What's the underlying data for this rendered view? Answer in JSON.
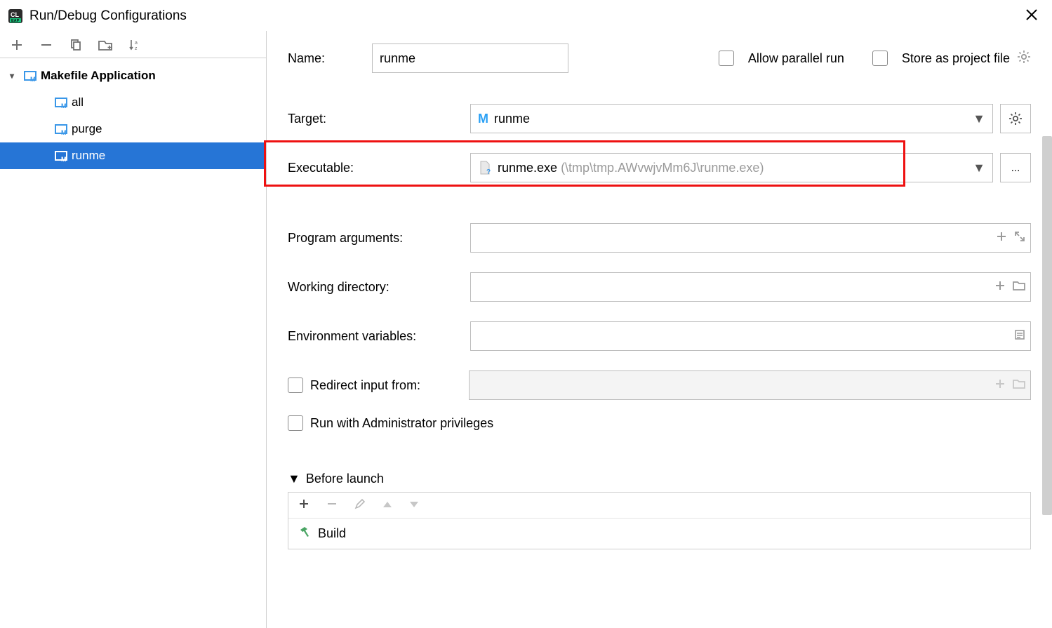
{
  "titlebar": {
    "title": "Run/Debug Configurations"
  },
  "sidebar": {
    "root_label": "Makefile Application",
    "items": [
      "all",
      "purge",
      "runme"
    ],
    "selected": "runme"
  },
  "form": {
    "name_label": "Name:",
    "name_value": "runme",
    "allow_parallel": "Allow parallel run",
    "store_as_project": "Store as project file",
    "target_label": "Target:",
    "target_value": "runme",
    "executable_label": "Executable:",
    "executable_name": "runme.exe",
    "executable_path": "(\\tmp\\tmp.AWvwjvMm6J\\runme.exe)",
    "program_args_label": "Program arguments:",
    "working_dir_label": "Working directory:",
    "env_vars_label": "Environment variables:",
    "redirect_label": "Redirect input from:",
    "admin_label": "Run with Administrator privileges",
    "before_launch_label": "Before launch",
    "before_launch_item": "Build",
    "browse_btn": "..."
  }
}
